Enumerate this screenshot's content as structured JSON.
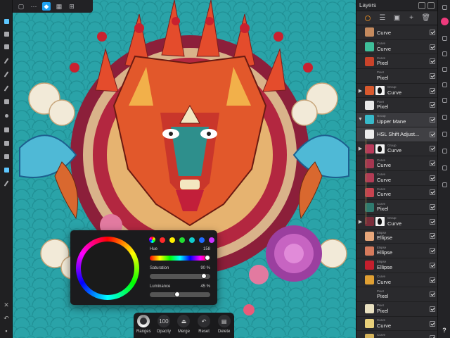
{
  "layers_panel": {
    "title": "Layers",
    "rows": [
      {
        "type": "",
        "name": "Curve",
        "thumb": "#c48a5e",
        "mask": false
      },
      {
        "type": "Curve",
        "name": "Curve",
        "thumb": "#3fbf9a",
        "mask": false
      },
      {
        "type": "Curve",
        "name": "Pixel",
        "thumb": "#c9432a",
        "mask": false
      },
      {
        "type": "Pixel",
        "name": "Pixel",
        "thumb": "#2a2a2d",
        "mask": false
      },
      {
        "type": "Group",
        "name": "Curve",
        "thumb": "#d8592e",
        "mask": true,
        "expander": "▶"
      },
      {
        "type": "Pixel",
        "name": "Pixel",
        "thumb": "#e9e9e9",
        "mask": false
      },
      {
        "type": "Group",
        "name": "Upper Mane",
        "thumb": "#37b9c9",
        "mask": false,
        "expander": "▼",
        "selected": true
      },
      {
        "type": "",
        "name": "HSL Shift Adjust...",
        "thumb": "#ededed",
        "mask": false,
        "adjust": true
      },
      {
        "type": "Group",
        "name": "Curve",
        "thumb": "#b83a5a",
        "mask": true,
        "expander": "▶"
      },
      {
        "type": "Curve",
        "name": "Curve",
        "thumb": "#a53650",
        "mask": false
      },
      {
        "type": "Curve",
        "name": "Curve",
        "thumb": "#b23c55",
        "mask": false
      },
      {
        "type": "Curve",
        "name": "Curve",
        "thumb": "#c7434f",
        "mask": false
      },
      {
        "type": "Curve",
        "name": "Pixel",
        "thumb": "#2f7b6f",
        "mask": false
      },
      {
        "type": "Group",
        "name": "Curve",
        "thumb": "#7a2d3a",
        "mask": true,
        "expander": "▶"
      },
      {
        "type": "Ellipse",
        "name": "Ellipse",
        "thumb": "#e7a77b",
        "mask": false
      },
      {
        "type": "Ellipse",
        "name": "Ellipse",
        "thumb": "#d67a5c",
        "mask": false
      },
      {
        "type": "Ellipse",
        "name": "Ellipse",
        "thumb": "#c41f2d",
        "mask": false
      },
      {
        "type": "Curve",
        "name": "Curve",
        "thumb": "#e0a033",
        "mask": false
      },
      {
        "type": "Pixel",
        "name": "Pixel",
        "thumb": "#2a2a2d",
        "mask": false
      },
      {
        "type": "Pixel",
        "name": "Pixel",
        "thumb": "#e8e0c0",
        "mask": false
      },
      {
        "type": "Curve",
        "name": "Curve",
        "thumb": "#e8d07a",
        "mask": false
      },
      {
        "type": "Curve",
        "name": "Curve",
        "thumb": "#d4b35a",
        "mask": false
      }
    ]
  },
  "color_popover": {
    "hue_label": "Hue",
    "hue_value": "158",
    "saturation_label": "Saturation",
    "saturation_value": "90 %",
    "saturation_fraction": 0.9,
    "luminance_label": "Luminance",
    "luminance_value": "45 %",
    "luminance_fraction": 0.45,
    "hue_fraction": 0.95,
    "swatches": [
      "ring",
      "#ff2a2a",
      "#ffee00",
      "#22dd33",
      "#11cccc",
      "#1e6bff",
      "#cc33ff"
    ]
  },
  "context_toolbar": {
    "ranges": "Ranges",
    "opacity": "Opacity",
    "opacity_value": "100",
    "merge": "Merge",
    "reset": "Reset",
    "delete": "Delete"
  }
}
